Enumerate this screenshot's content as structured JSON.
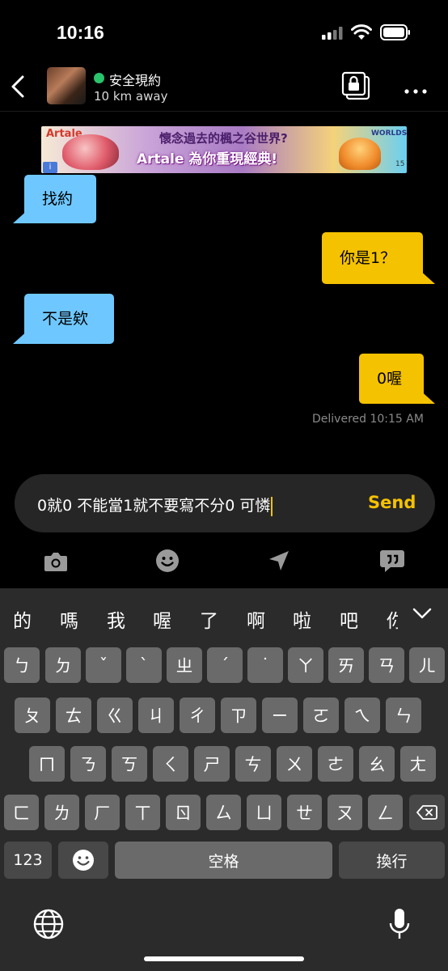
{
  "status": {
    "time": "10:16"
  },
  "header": {
    "name": "安全現約",
    "distance": "10 km away"
  },
  "ad": {
    "brand": "Artale",
    "line1": "懷念過去的楓之谷世界?",
    "line2": "Artale 為你重現經典!",
    "badge": "WORLDS",
    "age": "15"
  },
  "messages": [
    {
      "dir": "in",
      "text": "找約"
    },
    {
      "dir": "out",
      "text": "你是1？"
    },
    {
      "dir": "in",
      "text": "不是欸"
    },
    {
      "dir": "out",
      "text": "0喔"
    }
  ],
  "receipt": "Delivered 10:15 AM",
  "composer": {
    "value": "0就0 不能當1就不要寫不分0 可憐",
    "send_label": "Send"
  },
  "toolbar": [
    "camera-icon",
    "emoji-icon",
    "location-icon",
    "phrases-icon"
  ],
  "candidates": [
    "的",
    "嗎",
    "我",
    "喔",
    "了",
    "啊",
    "啦",
    "吧",
    "你"
  ],
  "keyboard": {
    "row1": [
      "ㄅ",
      "ㄉ",
      "ˇ",
      "ˋ",
      "ㄓ",
      "ˊ",
      "˙",
      "ㄚ",
      "ㄞ",
      "ㄢ",
      "ㄦ"
    ],
    "row2": [
      "ㄆ",
      "ㄊ",
      "ㄍ",
      "ㄐ",
      "ㄔ",
      "ㄗ",
      "ㄧ",
      "ㄛ",
      "ㄟ",
      "ㄣ"
    ],
    "row3": [
      "ㄇ",
      "ㄋ",
      "ㄎ",
      "ㄑ",
      "ㄕ",
      "ㄘ",
      "ㄨ",
      "ㄜ",
      "ㄠ",
      "ㄤ"
    ],
    "row4": [
      "ㄈ",
      "ㄌ",
      "ㄏ",
      "ㄒ",
      "ㄖ",
      "ㄙ",
      "ㄩ",
      "ㄝ",
      "ㄡ",
      "ㄥ"
    ],
    "numbers_label": "123",
    "space_label": "空格",
    "return_label": "換行"
  },
  "colors": {
    "incoming": "#6ec8ff",
    "outgoing": "#f5c200",
    "accent": "#f5c200",
    "online": "#29c46b"
  }
}
